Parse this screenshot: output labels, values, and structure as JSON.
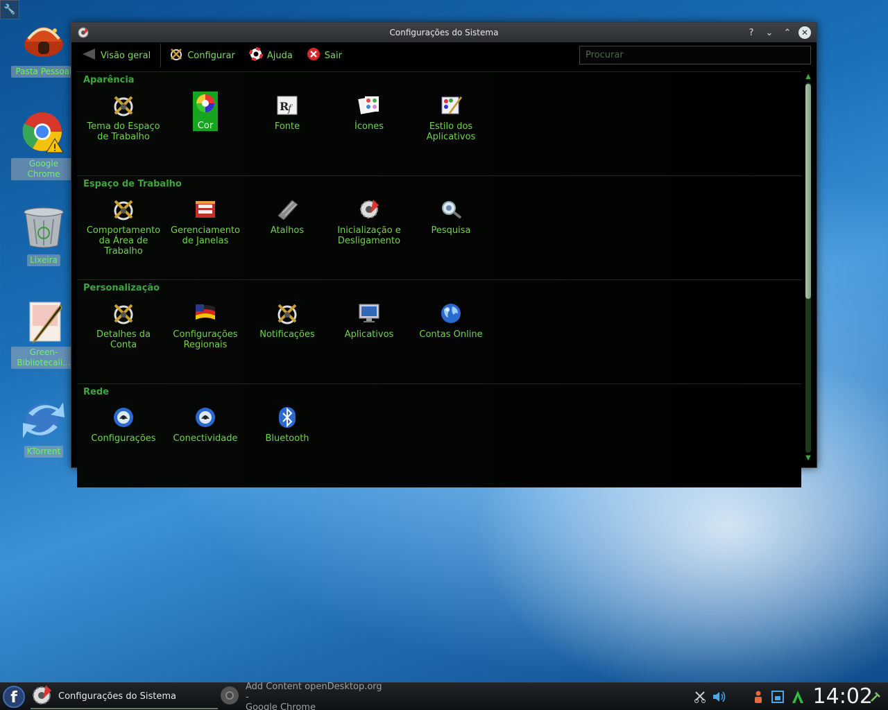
{
  "desktop": {
    "icons": [
      {
        "label": "Pasta Pessoal",
        "icon": "home-folder-icon"
      },
      {
        "label": "Google Chrome",
        "icon": "chrome-icon"
      },
      {
        "label": "Lixeira",
        "icon": "trash-icon"
      },
      {
        "label": "Green-Bibliotecali...",
        "icon": "document-pen-icon"
      },
      {
        "label": "KTorrent",
        "icon": "ktorrent-icon"
      }
    ]
  },
  "window": {
    "title": "Configurações do Sistema",
    "controls": [
      "?",
      "⌄",
      "⌃",
      "✕"
    ]
  },
  "toolbar": {
    "overview": "Visão geral",
    "configure": "Configurar",
    "help": "Ajuda",
    "quit": "Sair",
    "search_placeholder": "Procurar"
  },
  "sections": [
    {
      "title": "Aparência",
      "items": [
        {
          "label": "Tema do Espaço de Trabalho",
          "icon": "workspace-theme-icon"
        },
        {
          "label": "Cor",
          "icon": "color-wheel-icon",
          "selected": true
        },
        {
          "label": "Fonte",
          "icon": "font-icon"
        },
        {
          "label": "Ícones",
          "icon": "icons-icon"
        },
        {
          "label": "Estilo dos Aplicativos",
          "icon": "app-style-icon"
        }
      ]
    },
    {
      "title": "Espaço de Trabalho",
      "items": [
        {
          "label": "Comportamento da Área de Trabalho",
          "icon": "desktop-behavior-icon"
        },
        {
          "label": "Gerenciamento de Janelas",
          "icon": "window-management-icon"
        },
        {
          "label": "Atalhos",
          "icon": "keyboard-shortcut-icon"
        },
        {
          "label": "Inicialização e Desligamento",
          "icon": "startup-icon"
        },
        {
          "label": "Pesquisa",
          "icon": "search-icon"
        }
      ]
    },
    {
      "title": "Personalização",
      "items": [
        {
          "label": "Detalhes da Conta",
          "icon": "account-details-icon"
        },
        {
          "label": "Configurações Regionais",
          "icon": "flag-icon"
        },
        {
          "label": "Notificações",
          "icon": "notifications-icon"
        },
        {
          "label": "Aplicativos",
          "icon": "monitor-icon"
        },
        {
          "label": "Contas Online",
          "icon": "globe-icon"
        }
      ]
    },
    {
      "title": "Rede",
      "items": [
        {
          "label": "Configurações",
          "icon": "network-settings-icon"
        },
        {
          "label": "Conectividade",
          "icon": "connectivity-icon"
        },
        {
          "label": "Bluetooth",
          "icon": "bluetooth-icon"
        }
      ]
    }
  ],
  "taskbar": {
    "active_task": "Configurações do Sistema",
    "inactive_task_line1": "Add  Content openDesktop.org -",
    "inactive_task_line2": "Google Chrome",
    "clock": "14:02"
  },
  "colors": {
    "accent_green": "#6fd64a",
    "section_green": "#3aa83a",
    "selected_bg": "#17a51f"
  }
}
